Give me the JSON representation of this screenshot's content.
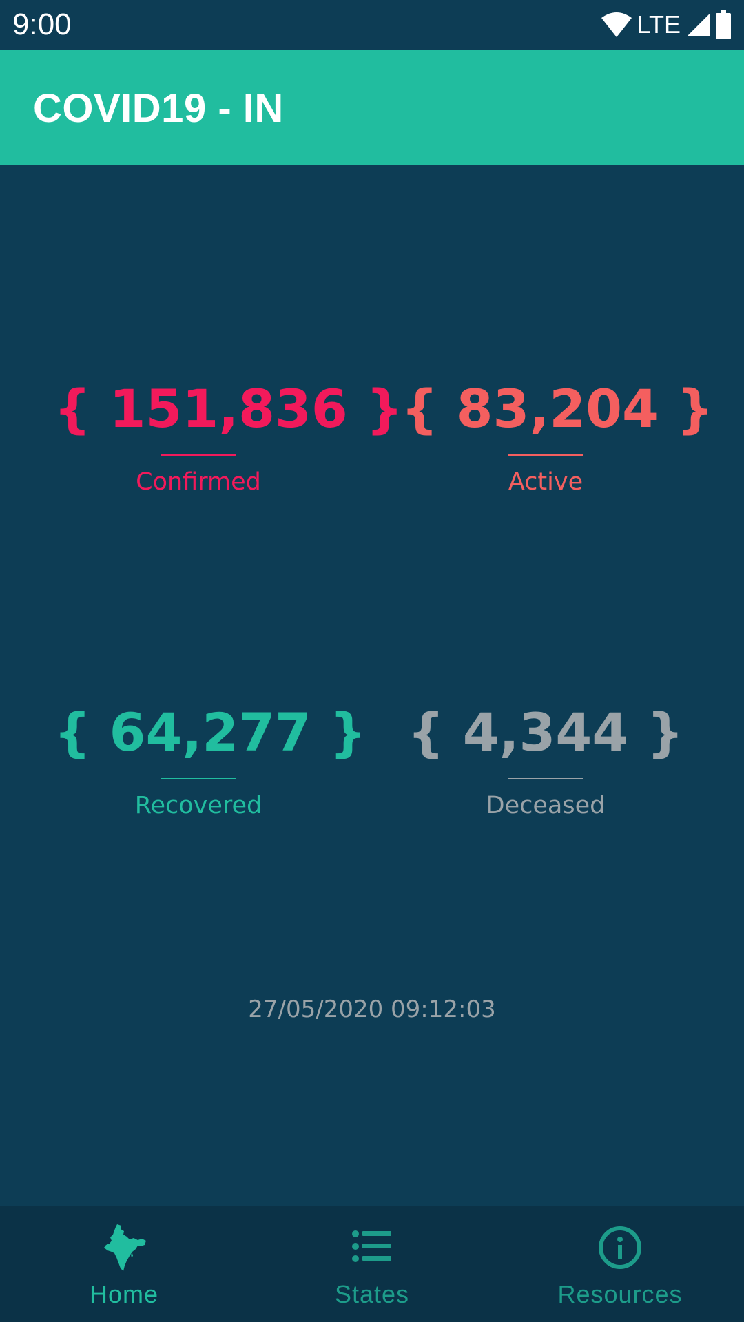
{
  "status_bar": {
    "time": "9:00",
    "network": "LTE",
    "icons": [
      "wifi-icon",
      "signal-icon",
      "battery-icon"
    ]
  },
  "app_bar": {
    "title": "COVID19 - IN"
  },
  "stats": {
    "confirmed": {
      "value": "{ 151,836 }",
      "label": "Confirmed",
      "color": "#f21a5b"
    },
    "active": {
      "value": "{ 83,204 }",
      "label": "Active",
      "color": "#f45f5f"
    },
    "recovered": {
      "value": "{ 64,277 }",
      "label": "Recovered",
      "color": "#21bd9f"
    },
    "deceased": {
      "value": "{ 4,344 }",
      "label": "Deceased",
      "color": "#9aa3a8"
    }
  },
  "last_updated": "27/05/2020 09:12:03",
  "bottom_nav": {
    "items": [
      {
        "label": "Home",
        "icon": "india-map-icon",
        "active": true
      },
      {
        "label": "States",
        "icon": "list-icon",
        "active": false
      },
      {
        "label": "Resources",
        "icon": "info-icon",
        "active": false
      }
    ],
    "active_color": "#21bd9f",
    "inactive_color": "#1d9c8a"
  },
  "colors": {
    "background": "#0d3d55",
    "app_bar": "#21bd9f",
    "nav_background": "#0b3247"
  }
}
